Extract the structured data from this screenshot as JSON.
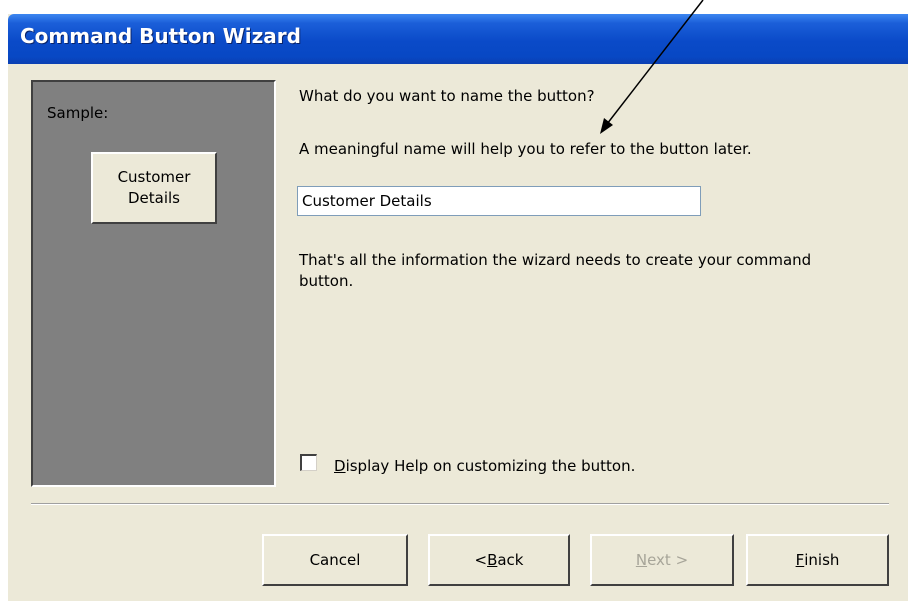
{
  "window": {
    "title": "Command Button Wizard"
  },
  "sample": {
    "label": "Sample:",
    "button_line1": "Customer",
    "button_line2": "Details"
  },
  "prompt": {
    "question": "What do you want to name the button?",
    "hint": "A meaningful name will help you to refer to the button later.",
    "name_value": "Customer Details",
    "info": "That's all the information the wizard needs to create your command button."
  },
  "help_checkbox": {
    "label": "Display Help on customizing the button.",
    "checked": false
  },
  "buttons": {
    "cancel": "Cancel",
    "back": "< Back",
    "next": "Next >",
    "finish": "Finish",
    "next_enabled": false
  },
  "colors": {
    "title_bar": "#0a4ac8",
    "dialog_bg": "#ece9d8",
    "sample_panel": "#808080",
    "disabled_text": "#a7a599"
  },
  "icons": {
    "annotation": "arrow-pointer-icon"
  }
}
